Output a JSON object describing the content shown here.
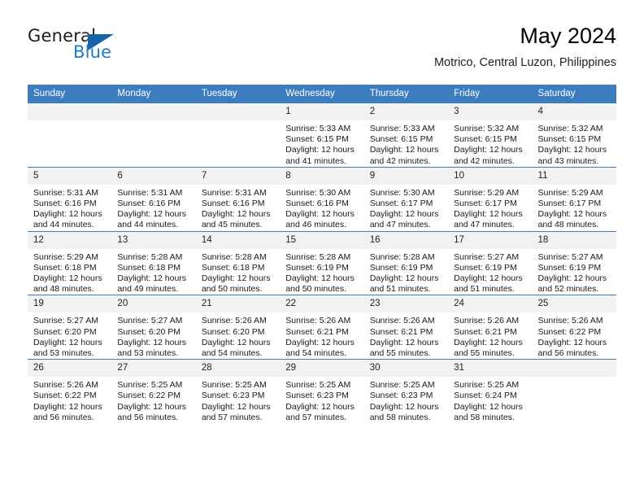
{
  "brand": {
    "name_part1": "General",
    "name_part2": "Blue",
    "triangle_color": "#1565a8",
    "blue_text_color": "#1f7cc4"
  },
  "header": {
    "title": "May 2024",
    "subtitle": "Motrico, Central Luzon, Philippines"
  },
  "theme": {
    "header_bar_color": "#3c7dbf",
    "daynum_band_color": "#f2f2f2",
    "row_rule_color": "#3c7dbf"
  },
  "weekday_headers": [
    "Sunday",
    "Monday",
    "Tuesday",
    "Wednesday",
    "Thursday",
    "Friday",
    "Saturday"
  ],
  "labels": {
    "sunrise_prefix": "Sunrise:",
    "sunset_prefix": "Sunset:",
    "daylight_prefix": "Daylight:"
  },
  "weeks": [
    [
      {
        "day": "",
        "empty": true
      },
      {
        "day": "",
        "empty": true
      },
      {
        "day": "",
        "empty": true
      },
      {
        "day": "1",
        "sunrise": "Sunrise: 5:33 AM",
        "sunset": "Sunset: 6:15 PM",
        "daylight_l1": "Daylight: 12 hours",
        "daylight_l2": "and 41 minutes."
      },
      {
        "day": "2",
        "sunrise": "Sunrise: 5:33 AM",
        "sunset": "Sunset: 6:15 PM",
        "daylight_l1": "Daylight: 12 hours",
        "daylight_l2": "and 42 minutes."
      },
      {
        "day": "3",
        "sunrise": "Sunrise: 5:32 AM",
        "sunset": "Sunset: 6:15 PM",
        "daylight_l1": "Daylight: 12 hours",
        "daylight_l2": "and 42 minutes."
      },
      {
        "day": "4",
        "sunrise": "Sunrise: 5:32 AM",
        "sunset": "Sunset: 6:15 PM",
        "daylight_l1": "Daylight: 12 hours",
        "daylight_l2": "and 43 minutes."
      }
    ],
    [
      {
        "day": "5",
        "sunrise": "Sunrise: 5:31 AM",
        "sunset": "Sunset: 6:16 PM",
        "daylight_l1": "Daylight: 12 hours",
        "daylight_l2": "and 44 minutes."
      },
      {
        "day": "6",
        "sunrise": "Sunrise: 5:31 AM",
        "sunset": "Sunset: 6:16 PM",
        "daylight_l1": "Daylight: 12 hours",
        "daylight_l2": "and 44 minutes."
      },
      {
        "day": "7",
        "sunrise": "Sunrise: 5:31 AM",
        "sunset": "Sunset: 6:16 PM",
        "daylight_l1": "Daylight: 12 hours",
        "daylight_l2": "and 45 minutes."
      },
      {
        "day": "8",
        "sunrise": "Sunrise: 5:30 AM",
        "sunset": "Sunset: 6:16 PM",
        "daylight_l1": "Daylight: 12 hours",
        "daylight_l2": "and 46 minutes."
      },
      {
        "day": "9",
        "sunrise": "Sunrise: 5:30 AM",
        "sunset": "Sunset: 6:17 PM",
        "daylight_l1": "Daylight: 12 hours",
        "daylight_l2": "and 47 minutes."
      },
      {
        "day": "10",
        "sunrise": "Sunrise: 5:29 AM",
        "sunset": "Sunset: 6:17 PM",
        "daylight_l1": "Daylight: 12 hours",
        "daylight_l2": "and 47 minutes."
      },
      {
        "day": "11",
        "sunrise": "Sunrise: 5:29 AM",
        "sunset": "Sunset: 6:17 PM",
        "daylight_l1": "Daylight: 12 hours",
        "daylight_l2": "and 48 minutes."
      }
    ],
    [
      {
        "day": "12",
        "sunrise": "Sunrise: 5:29 AM",
        "sunset": "Sunset: 6:18 PM",
        "daylight_l1": "Daylight: 12 hours",
        "daylight_l2": "and 48 minutes."
      },
      {
        "day": "13",
        "sunrise": "Sunrise: 5:28 AM",
        "sunset": "Sunset: 6:18 PM",
        "daylight_l1": "Daylight: 12 hours",
        "daylight_l2": "and 49 minutes."
      },
      {
        "day": "14",
        "sunrise": "Sunrise: 5:28 AM",
        "sunset": "Sunset: 6:18 PM",
        "daylight_l1": "Daylight: 12 hours",
        "daylight_l2": "and 50 minutes."
      },
      {
        "day": "15",
        "sunrise": "Sunrise: 5:28 AM",
        "sunset": "Sunset: 6:19 PM",
        "daylight_l1": "Daylight: 12 hours",
        "daylight_l2": "and 50 minutes."
      },
      {
        "day": "16",
        "sunrise": "Sunrise: 5:28 AM",
        "sunset": "Sunset: 6:19 PM",
        "daylight_l1": "Daylight: 12 hours",
        "daylight_l2": "and 51 minutes."
      },
      {
        "day": "17",
        "sunrise": "Sunrise: 5:27 AM",
        "sunset": "Sunset: 6:19 PM",
        "daylight_l1": "Daylight: 12 hours",
        "daylight_l2": "and 51 minutes."
      },
      {
        "day": "18",
        "sunrise": "Sunrise: 5:27 AM",
        "sunset": "Sunset: 6:19 PM",
        "daylight_l1": "Daylight: 12 hours",
        "daylight_l2": "and 52 minutes."
      }
    ],
    [
      {
        "day": "19",
        "sunrise": "Sunrise: 5:27 AM",
        "sunset": "Sunset: 6:20 PM",
        "daylight_l1": "Daylight: 12 hours",
        "daylight_l2": "and 53 minutes."
      },
      {
        "day": "20",
        "sunrise": "Sunrise: 5:27 AM",
        "sunset": "Sunset: 6:20 PM",
        "daylight_l1": "Daylight: 12 hours",
        "daylight_l2": "and 53 minutes."
      },
      {
        "day": "21",
        "sunrise": "Sunrise: 5:26 AM",
        "sunset": "Sunset: 6:20 PM",
        "daylight_l1": "Daylight: 12 hours",
        "daylight_l2": "and 54 minutes."
      },
      {
        "day": "22",
        "sunrise": "Sunrise: 5:26 AM",
        "sunset": "Sunset: 6:21 PM",
        "daylight_l1": "Daylight: 12 hours",
        "daylight_l2": "and 54 minutes."
      },
      {
        "day": "23",
        "sunrise": "Sunrise: 5:26 AM",
        "sunset": "Sunset: 6:21 PM",
        "daylight_l1": "Daylight: 12 hours",
        "daylight_l2": "and 55 minutes."
      },
      {
        "day": "24",
        "sunrise": "Sunrise: 5:26 AM",
        "sunset": "Sunset: 6:21 PM",
        "daylight_l1": "Daylight: 12 hours",
        "daylight_l2": "and 55 minutes."
      },
      {
        "day": "25",
        "sunrise": "Sunrise: 5:26 AM",
        "sunset": "Sunset: 6:22 PM",
        "daylight_l1": "Daylight: 12 hours",
        "daylight_l2": "and 56 minutes."
      }
    ],
    [
      {
        "day": "26",
        "sunrise": "Sunrise: 5:26 AM",
        "sunset": "Sunset: 6:22 PM",
        "daylight_l1": "Daylight: 12 hours",
        "daylight_l2": "and 56 minutes."
      },
      {
        "day": "27",
        "sunrise": "Sunrise: 5:25 AM",
        "sunset": "Sunset: 6:22 PM",
        "daylight_l1": "Daylight: 12 hours",
        "daylight_l2": "and 56 minutes."
      },
      {
        "day": "28",
        "sunrise": "Sunrise: 5:25 AM",
        "sunset": "Sunset: 6:23 PM",
        "daylight_l1": "Daylight: 12 hours",
        "daylight_l2": "and 57 minutes."
      },
      {
        "day": "29",
        "sunrise": "Sunrise: 5:25 AM",
        "sunset": "Sunset: 6:23 PM",
        "daylight_l1": "Daylight: 12 hours",
        "daylight_l2": "and 57 minutes."
      },
      {
        "day": "30",
        "sunrise": "Sunrise: 5:25 AM",
        "sunset": "Sunset: 6:23 PM",
        "daylight_l1": "Daylight: 12 hours",
        "daylight_l2": "and 58 minutes."
      },
      {
        "day": "31",
        "sunrise": "Sunrise: 5:25 AM",
        "sunset": "Sunset: 6:24 PM",
        "daylight_l1": "Daylight: 12 hours",
        "daylight_l2": "and 58 minutes."
      },
      {
        "day": "",
        "empty": true
      }
    ]
  ]
}
